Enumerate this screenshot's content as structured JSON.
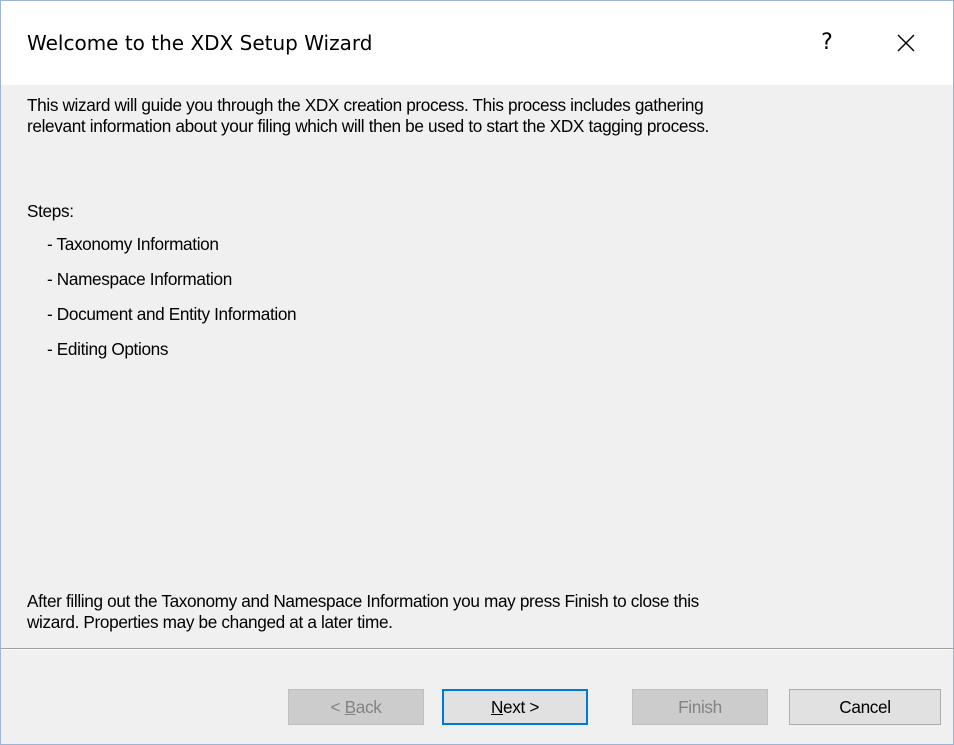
{
  "dialog": {
    "title": "Welcome to the XDX Setup Wizard",
    "help_label": "?",
    "close_icon": "close-icon"
  },
  "content": {
    "intro_line1": "This wizard will guide you through the XDX creation process.  This process includes gathering",
    "intro_line2": "relevant information about your filing which will then be used to start the XDX tagging process.",
    "steps_label": "Steps:",
    "steps": [
      "- Taxonomy Information",
      "- Namespace Information",
      "- Document and Entity Information",
      "- Editing Options"
    ],
    "outro_line1": "After filling out the Taxonomy and Namespace Information you may press Finish to close this",
    "outro_line2": "wizard.  Properties may be changed at a later time."
  },
  "buttons": {
    "back_prefix": "< ",
    "back_mnemonic": "B",
    "back_rest": "ack",
    "next_mnemonic": "N",
    "next_rest": "ext >",
    "finish": "Finish",
    "cancel": "Cancel"
  },
  "colors": {
    "default_button_border": "#0078d7",
    "window_border": "#9fb4d3",
    "background": "#f0f0f0"
  }
}
